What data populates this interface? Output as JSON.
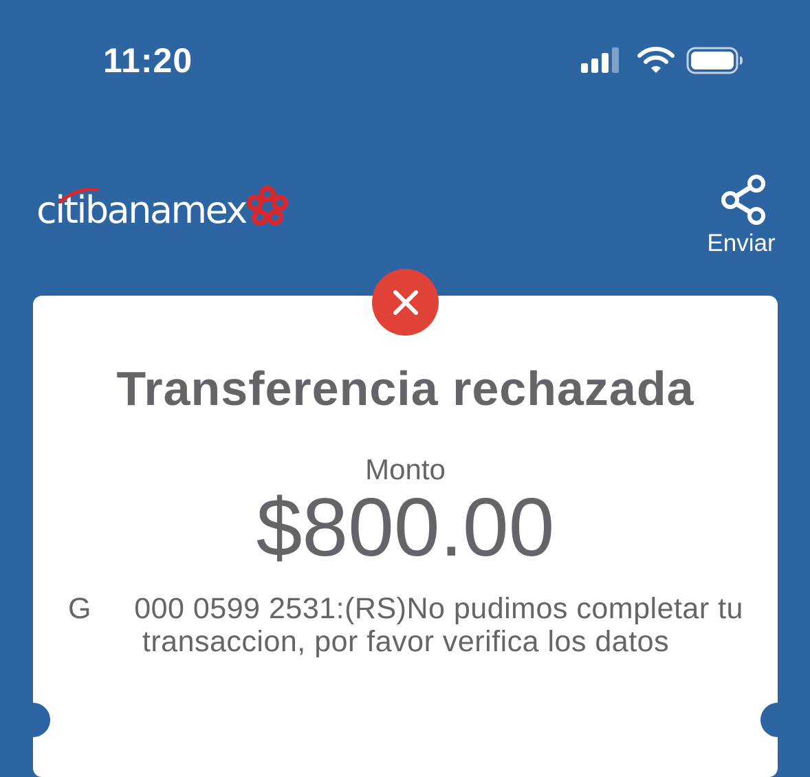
{
  "status_bar": {
    "time": "11:20",
    "signal_icon": "cellular-signal-icon",
    "wifi_icon": "wifi-icon",
    "battery_icon": "battery-icon"
  },
  "header": {
    "logo_text": "citibanamex",
    "logo_mark_icon": "banamex-flower-logo",
    "share": {
      "icon": "share-icon",
      "label": "Enviar"
    }
  },
  "receipt": {
    "status_icon": "close-x-icon",
    "title": "Transferencia rechazada",
    "amount_label": "Monto",
    "amount": "$800.00",
    "message": "G     000 0599 2531:(RS)No pudimos completar tu transaccion, por favor verifica los datos"
  },
  "colors": {
    "background": "#2d65a3",
    "card": "#ffffff",
    "text_gray": "#646469",
    "error_red": "#e14238",
    "logo_red": "#d8282e"
  }
}
